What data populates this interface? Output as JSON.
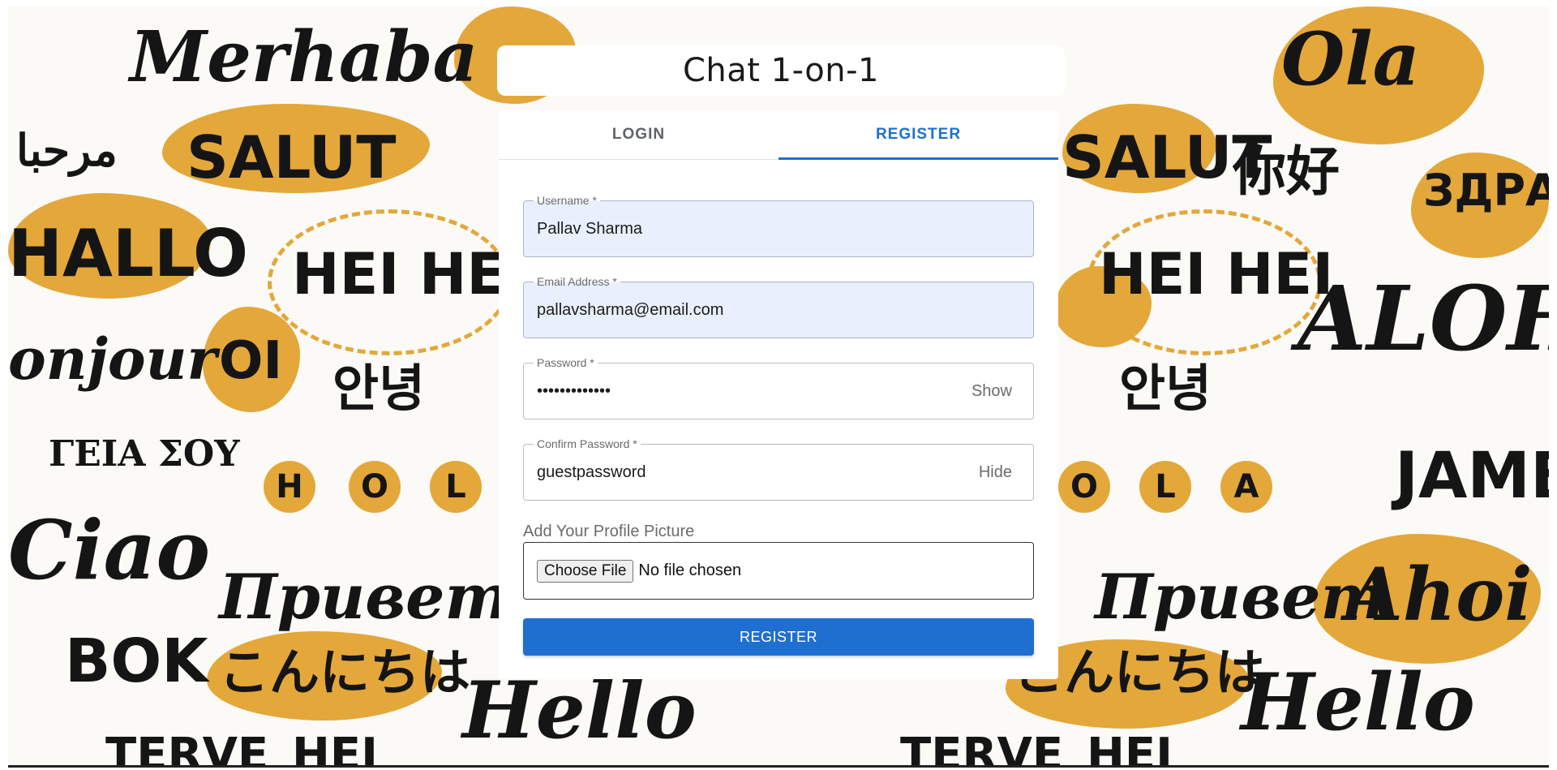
{
  "app": {
    "title": "Chat 1-on-1"
  },
  "tabs": [
    {
      "label": "LOGIN",
      "active": false
    },
    {
      "label": "REGISTER",
      "active": true
    }
  ],
  "form": {
    "username": {
      "label": "Username *",
      "value": "Pallav Sharma"
    },
    "email": {
      "label": "Email Address *",
      "value": "pallavsharma@email.com"
    },
    "password": {
      "label": "Password *",
      "value": "guestpassword",
      "toggle": "Show"
    },
    "confirm_password": {
      "label": "Confirm Password *",
      "value": "guestpassword",
      "toggle": "Hide"
    },
    "profile_picture": {
      "label": "Add Your Profile Picture",
      "button": "Choose File",
      "status": "No file chosen"
    },
    "submit_label": "REGISTER"
  },
  "background": {
    "greetings": [
      "Merhaba",
      "Ola",
      "SALUT",
      "مرحبا",
      "你好",
      "ЗДРАВО",
      "HALLO",
      "HEI HEI",
      "ALOHA",
      "onjour",
      "OI",
      "안녕",
      "ΓΕΙΑ ΣΟΥ",
      "HOLA",
      "JAMBO",
      "Ciao",
      "Привет",
      "Ahoi",
      "BOK",
      "こんにちは",
      "Hello",
      "TERVE",
      "HEJ"
    ]
  },
  "colors": {
    "accent": "#1f6fd1",
    "autofill": "#e8f0fe",
    "background_orange": "#e4a73a"
  }
}
